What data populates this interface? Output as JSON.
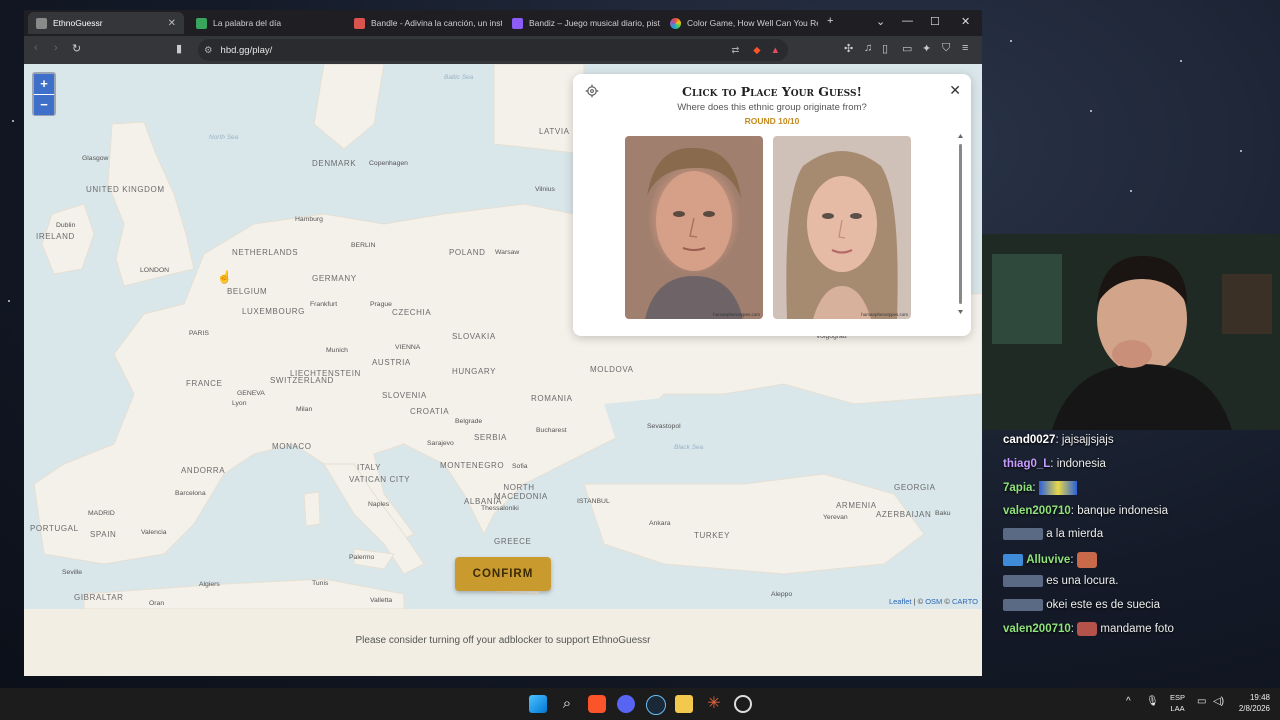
{
  "browser": {
    "tabs": [
      {
        "title": "EthnoGuessr",
        "active": true,
        "color": "#8a8a8a"
      },
      {
        "title": "La palabra del día",
        "active": false,
        "color": "#3aa55d"
      },
      {
        "title": "Bandle - Adivina la canción, un instr",
        "active": false,
        "color": "#d9534f"
      },
      {
        "title": "Bandiz – Juego musical diario, pista",
        "active": false,
        "color": "#8b5cf6"
      },
      {
        "title": "Color Game, How Well Can You Re",
        "active": false,
        "color": "#e74c3c"
      }
    ],
    "new_tab": "+",
    "url": "hbd.gg/play/"
  },
  "map": {
    "countries": [
      "UNITED KINGDOM",
      "IRELAND",
      "DENMARK",
      "NETHERLANDS",
      "BELGIUM",
      "LUXEMBOURG",
      "GERMANY",
      "POLAND",
      "CZECHIA",
      "SLOVAKIA",
      "AUSTRIA",
      "LIECHTENSTEIN",
      "SWITZERLAND",
      "FRANCE",
      "MONACO",
      "ANDORRA",
      "SPAIN",
      "PORTUGAL",
      "ITALY",
      "VATICAN CITY",
      "SLOVENIA",
      "CROATIA",
      "HUNGARY",
      "ROMANIA",
      "MOLDOVA",
      "SERBIA",
      "MONTENEGRO",
      "ALBANIA",
      "NORTH MACEDONIA",
      "GREECE",
      "TURKEY",
      "ARMENIA",
      "AZERBAIJAN",
      "GEORGIA",
      "LATVIA",
      "GIBRALTAR"
    ],
    "cities": [
      "Glasgow",
      "Dublin",
      "LONDON",
      "Copenhagen",
      "Hamburg",
      "BERLIN",
      "Warsaw",
      "Frankfurt",
      "Prague",
      "PARIS",
      "Munich",
      "VIENNA",
      "GENEVA",
      "Lyon",
      "Milan",
      "Barcelona",
      "MADRID",
      "Valencia",
      "Seville",
      "Algiers",
      "Tunis",
      "Palermo",
      "Valletta",
      "Naples",
      "Sarajevo",
      "Belgrade",
      "Sofia",
      "Bucharest",
      "Thessaloniki",
      "ISTANBUL",
      "Ankara",
      "Yerevan",
      "Baku",
      "Sevastopol",
      "Volgograd",
      "Vilnius",
      "Aleppo",
      "Oran"
    ],
    "seas": [
      "North Sea",
      "Baltic Sea",
      "Black Sea"
    ],
    "attribution": {
      "leaflet": "Leaflet",
      "osm": "OSM",
      "carto": "CARTO"
    }
  },
  "panel": {
    "title": "Click to Place Your Guess!",
    "subtitle": "Where does this ethnic group originate from?",
    "round": "ROUND 10/10",
    "close": "✕",
    "faces": [
      {
        "credit": "humanphenotypes.com",
        "tone": "#c8957f"
      },
      {
        "credit": "humanphenotypes.com",
        "tone": "#e0b49c"
      }
    ]
  },
  "confirm_label": "CONFIRM",
  "ad_notice": "Please consider turning off your adblocker to support EthnoGuessr",
  "chat": [
    {
      "user": "cand0027",
      "text": "jajsajjsjajs",
      "color": "#ffffff"
    },
    {
      "user": "thiag0_L",
      "text": "indonesia",
      "color": "#c99cff"
    },
    {
      "user": "7apia",
      "text": "",
      "color": "#8fe37a"
    },
    {
      "user": "valen200710",
      "text": "banque indonesia",
      "color": "#8fe37a"
    },
    {
      "user": "",
      "text": "a la mierda",
      "color": "#cfd8ff"
    },
    {
      "user": "Alluvive",
      "text": "",
      "color": "#8fe37a"
    },
    {
      "user": "",
      "text": "es una locura.",
      "color": "#cfd8ff"
    },
    {
      "user": "",
      "text": "okei este es de suecia",
      "color": "#cfd8ff"
    },
    {
      "user": "valen200710",
      "text": "mandame foto",
      "color": "#8fe37a"
    }
  ],
  "taskbar": {
    "lang_top": "ESP",
    "lang_bottom": "LAA",
    "time": "19:48",
    "date": "2/8/2026"
  }
}
